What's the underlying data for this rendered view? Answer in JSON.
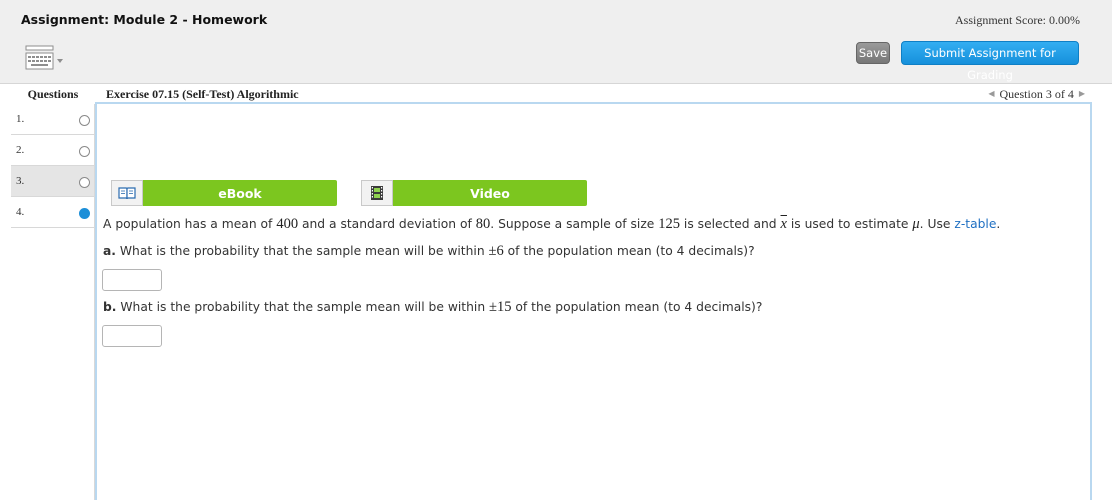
{
  "header": {
    "assignment_title": "Assignment: Module 2 - Homework",
    "score": "Assignment Score: 0.00%",
    "save_label": "Save",
    "submit_label": "Submit Assignment for Grading"
  },
  "questions_panel": {
    "heading": "Questions",
    "items": [
      {
        "number": "1.",
        "answered": false
      },
      {
        "number": "2.",
        "answered": false
      },
      {
        "number": "3.",
        "answered": false
      },
      {
        "number": "4.",
        "answered": true
      }
    ]
  },
  "exercise": {
    "title": "Exercise 07.15 (Self-Test) Algorithmic",
    "nav": "Question 3 of 4"
  },
  "resources": {
    "ebook_label": "eBook",
    "video_label": "Video"
  },
  "problem": {
    "intro_1": "A population has a mean of ",
    "mean": "400",
    "intro_2": " and a standard deviation of ",
    "sd": "80",
    "intro_3": ". Suppose a sample of size ",
    "n": "125",
    "intro_4": " is selected and ",
    "xbar": "x",
    "intro_5": " is used to estimate ",
    "mu": "μ",
    "intro_6": ". Use ",
    "ztable_link": "z-table",
    "intro_7": ".",
    "part_a": {
      "letter": "a.",
      "text_1": " What is the probability that the sample mean will be within ",
      "value": "±6",
      "text_2": " of the population mean (to 4 decimals)?",
      "answer": ""
    },
    "part_b": {
      "letter": "b.",
      "text_1": " What is the probability that the sample mean will be within ",
      "value": "±15",
      "text_2": " of the population mean (to 4 decimals)?",
      "answer": ""
    }
  },
  "colors": {
    "submit_blue": "#1d9be6",
    "resource_green": "#7cc61f",
    "answered_dot": "#1d8fd8"
  }
}
